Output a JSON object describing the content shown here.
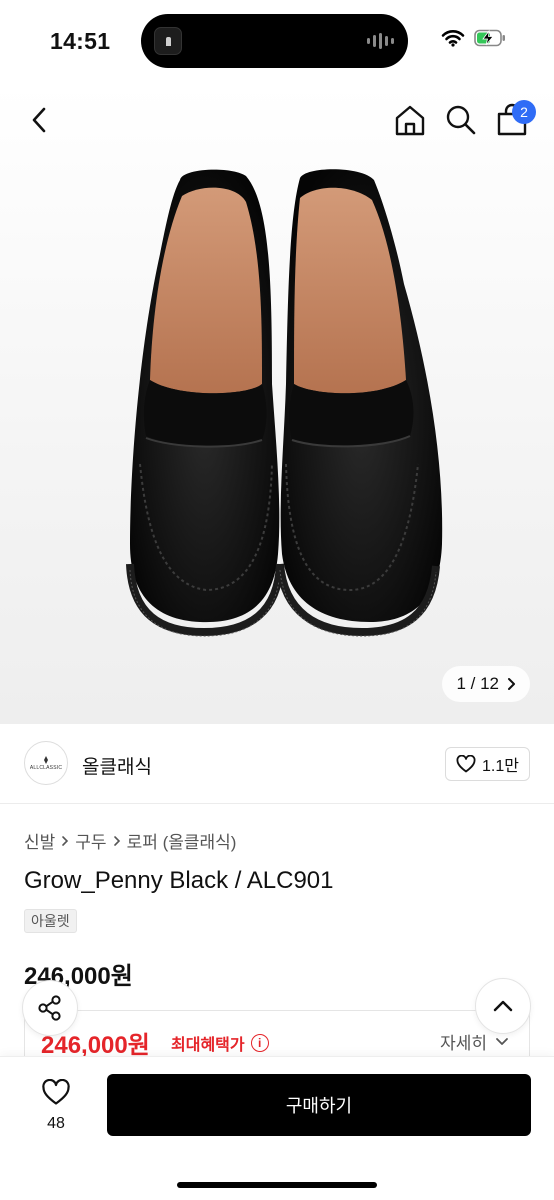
{
  "status": {
    "time": "14:51"
  },
  "header": {
    "cart_count": "2"
  },
  "gallery": {
    "counter": "1 / 12"
  },
  "brand": {
    "logo_text": "ALLCLASSIC",
    "name": "올클래식",
    "likes": "1.1만"
  },
  "breadcrumb": [
    "신발",
    "구두",
    "로퍼 (올클래식)"
  ],
  "product": {
    "title": "Grow_Penny Black / ALC901",
    "tag": "아울렛",
    "price": "246,000원",
    "benefit_price": "246,000원",
    "benefit_label": "최대혜택가",
    "detail_label": "자세히"
  },
  "bottom": {
    "wish_count": "48",
    "buy_label": "구매하기"
  },
  "colors": {
    "accent_red": "#e5252a",
    "badge_blue": "#2f6cf6",
    "buy_button": "#000000"
  }
}
